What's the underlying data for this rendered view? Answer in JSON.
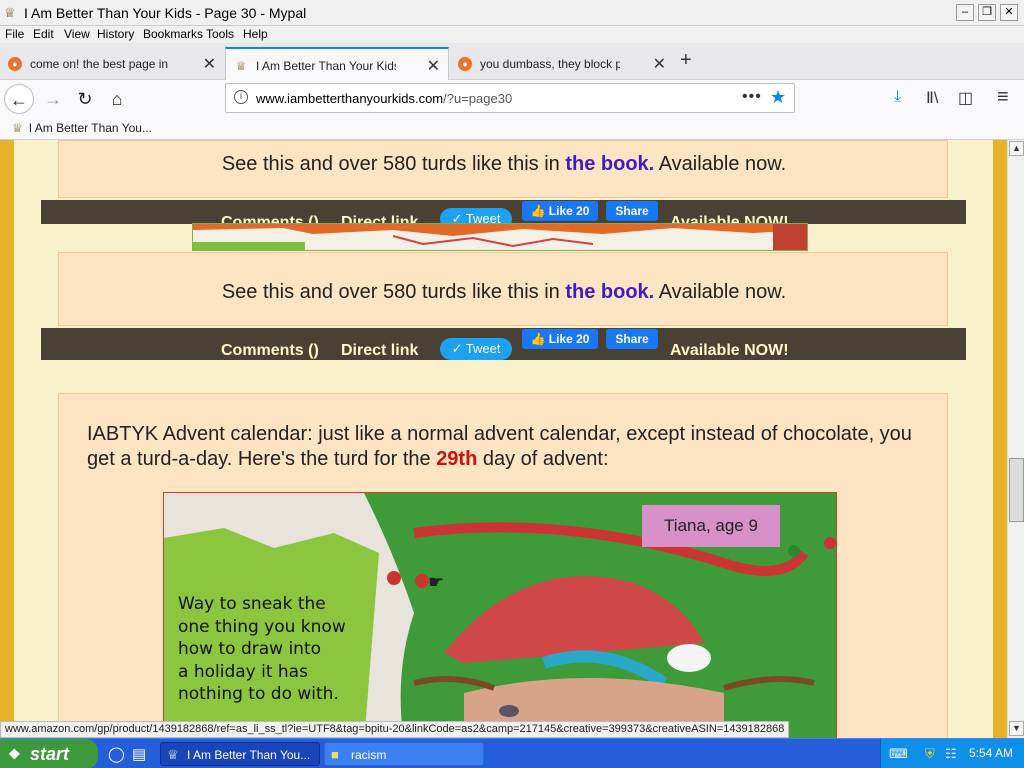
{
  "window": {
    "title": "I Am Better Than Your Kids - Page 30 - Mypal",
    "minimize": "‒",
    "restore": "❐",
    "close": "✕"
  },
  "menu": [
    "File",
    "Edit",
    "View",
    "History",
    "Bookmarks",
    "Tools",
    "Help"
  ],
  "tabs": [
    {
      "label": "come on! the best page in the uni",
      "active": false
    },
    {
      "label": "I Am Better Than Your Kids - Page",
      "active": true
    },
    {
      "label": "you dumbass, they block porn wel",
      "active": false
    }
  ],
  "toolbar": {
    "new_tab": "+",
    "back": "←",
    "forward": "→",
    "reload": "↻",
    "home": "⌂",
    "download": "⤓",
    "library": "Ⅱ\\",
    "sidebar": "◫",
    "menu": "≡"
  },
  "address": {
    "domain": "www.iambetterthanyourkids.com",
    "path": "/?u=page30",
    "info": "i",
    "dots": "•••",
    "star": "★"
  },
  "bookmarks": [
    {
      "label": "I Am Better Than You..."
    }
  ],
  "content": {
    "promo_pre": "See this and over 580 turds like this in ",
    "promo_link": "the book.",
    "promo_post": " Available now.",
    "share": {
      "comments": "Comments ()",
      "direct": "Direct link",
      "tweet": "✓ Tweet",
      "like": "👍 Like 20",
      "share": "Share",
      "available": "Available NOW!"
    },
    "post": {
      "text_pre": "IABTYK Advent calendar: just like a normal advent calendar, except instead of chocolate, you get a turd-a-day. Here's the turd for the ",
      "day": "29th",
      "text_post": " day of advent:",
      "caption": "Tiana, age 9",
      "handwriting": [
        "Way to sneak the",
        "one thing you know",
        "how to draw into",
        "a holiday it has",
        "nothing to do with."
      ]
    }
  },
  "status_url": "www.amazon.com/gp/product/1439182868/ref=as_li_ss_tl?ie=UTF8&tag=bpitu-20&linkCode=as2&camp=217145&creative=399373&creativeASIN=1439182868",
  "taskbar": {
    "start": "start",
    "items": [
      {
        "label": "I Am Better Than You...",
        "active": true
      },
      {
        "label": "racism",
        "active": false
      }
    ],
    "clock": "5:54 AM"
  }
}
